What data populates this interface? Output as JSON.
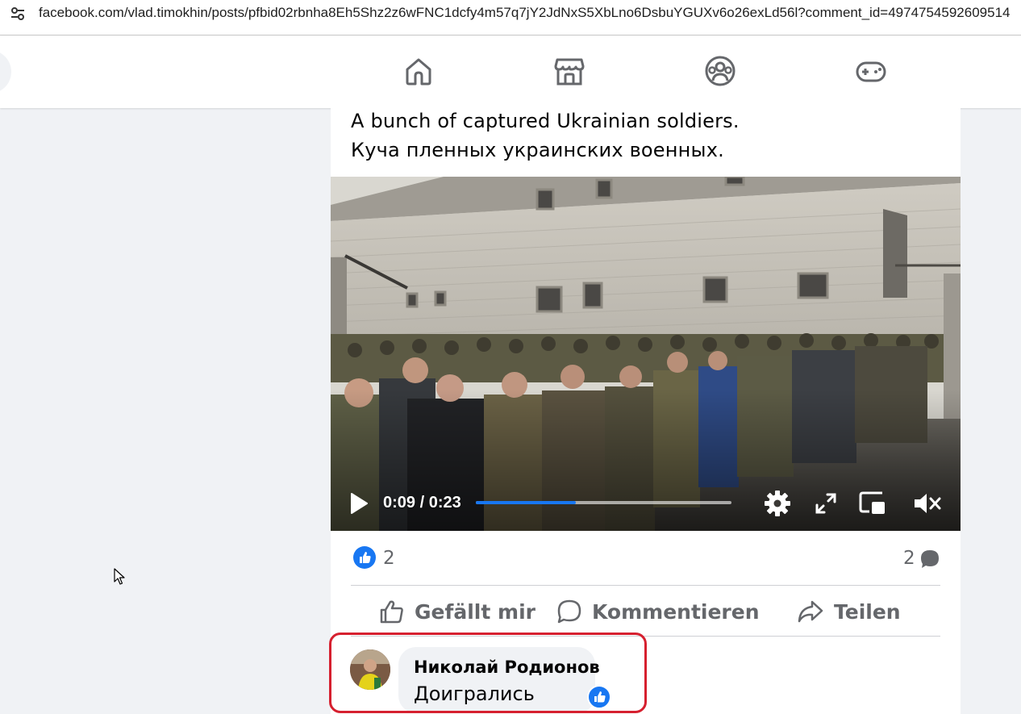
{
  "browser": {
    "url": "facebook.com/vlad.timokhin/posts/pfbid02rbnha8Eh5Shz2z6wFNC1dcfy4m57q7jY2JdNxS5XbLno6DsbuYGUXv6o26exLd56l?comment_id=4974754592609514",
    "site_icon": "tune-icon"
  },
  "nav": {
    "items": [
      {
        "name": "home-icon"
      },
      {
        "name": "marketplace-icon"
      },
      {
        "name": "groups-icon"
      },
      {
        "name": "gaming-icon"
      }
    ]
  },
  "post": {
    "text_line1": "A bunch of captured Ukrainian soldiers.",
    "text_line2": "Куча пленных украинских военных."
  },
  "video": {
    "time_label": "0:09 / 0:23",
    "progress": 0.39,
    "accent": "#1877f2"
  },
  "reactions": {
    "like_count": "2",
    "comment_count": "2"
  },
  "actions": {
    "like_label": "Gefällt mir",
    "comment_label": "Kommentieren",
    "share_label": "Teilen"
  },
  "comment": {
    "author": "Николай Родионов",
    "text": "Доигрались",
    "highlight_color": "#d6202f"
  }
}
